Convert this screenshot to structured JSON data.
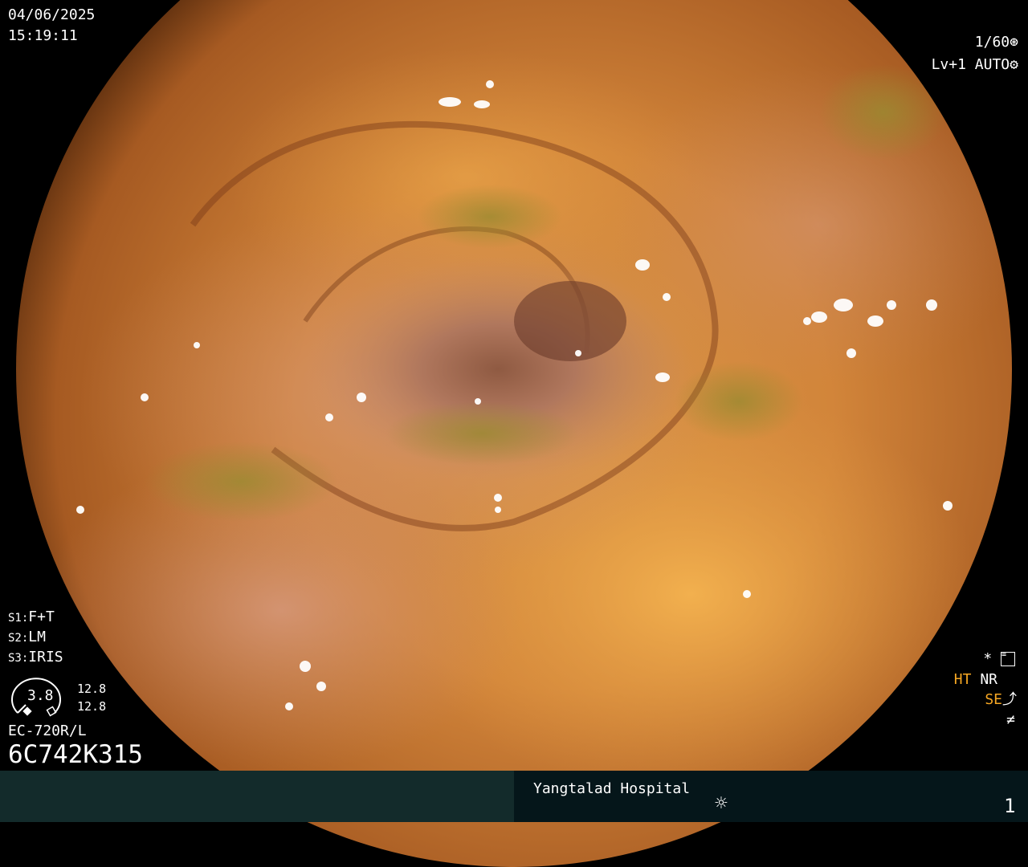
{
  "header": {
    "date": "04/06/2025",
    "time": "15:19:11"
  },
  "settings": {
    "shutter": "1/60",
    "level": "Lv+1",
    "iris_mode": "AUTO"
  },
  "switches": {
    "s1_key": "S1:",
    "s1": "F+T",
    "s2_key": "S2:",
    "s2": "LM",
    "s3_key": "S3:",
    "s3": "IRIS"
  },
  "gauge": {
    "value": "3.8",
    "upper": "12.8",
    "lower": "12.8"
  },
  "scope": {
    "model": "EC-720R/L",
    "serial": "6C742K315"
  },
  "modes": {
    "star": "*",
    "ht": "HT",
    "nr": "NR",
    "se": "SE",
    "f_symbol": "≠"
  },
  "footer": {
    "hospital": "Yangtalad Hospital",
    "page": "1"
  },
  "icons": {
    "shutter": "aperture-icon",
    "iris": "iris-icon",
    "menu": "settings-list-icon",
    "brightness": "sun-icon",
    "se": "enhance-curve-icon"
  },
  "colors": {
    "ht_se": "#f5a623",
    "bottom_left": "#132b2b",
    "bottom_right": "#05161a"
  }
}
